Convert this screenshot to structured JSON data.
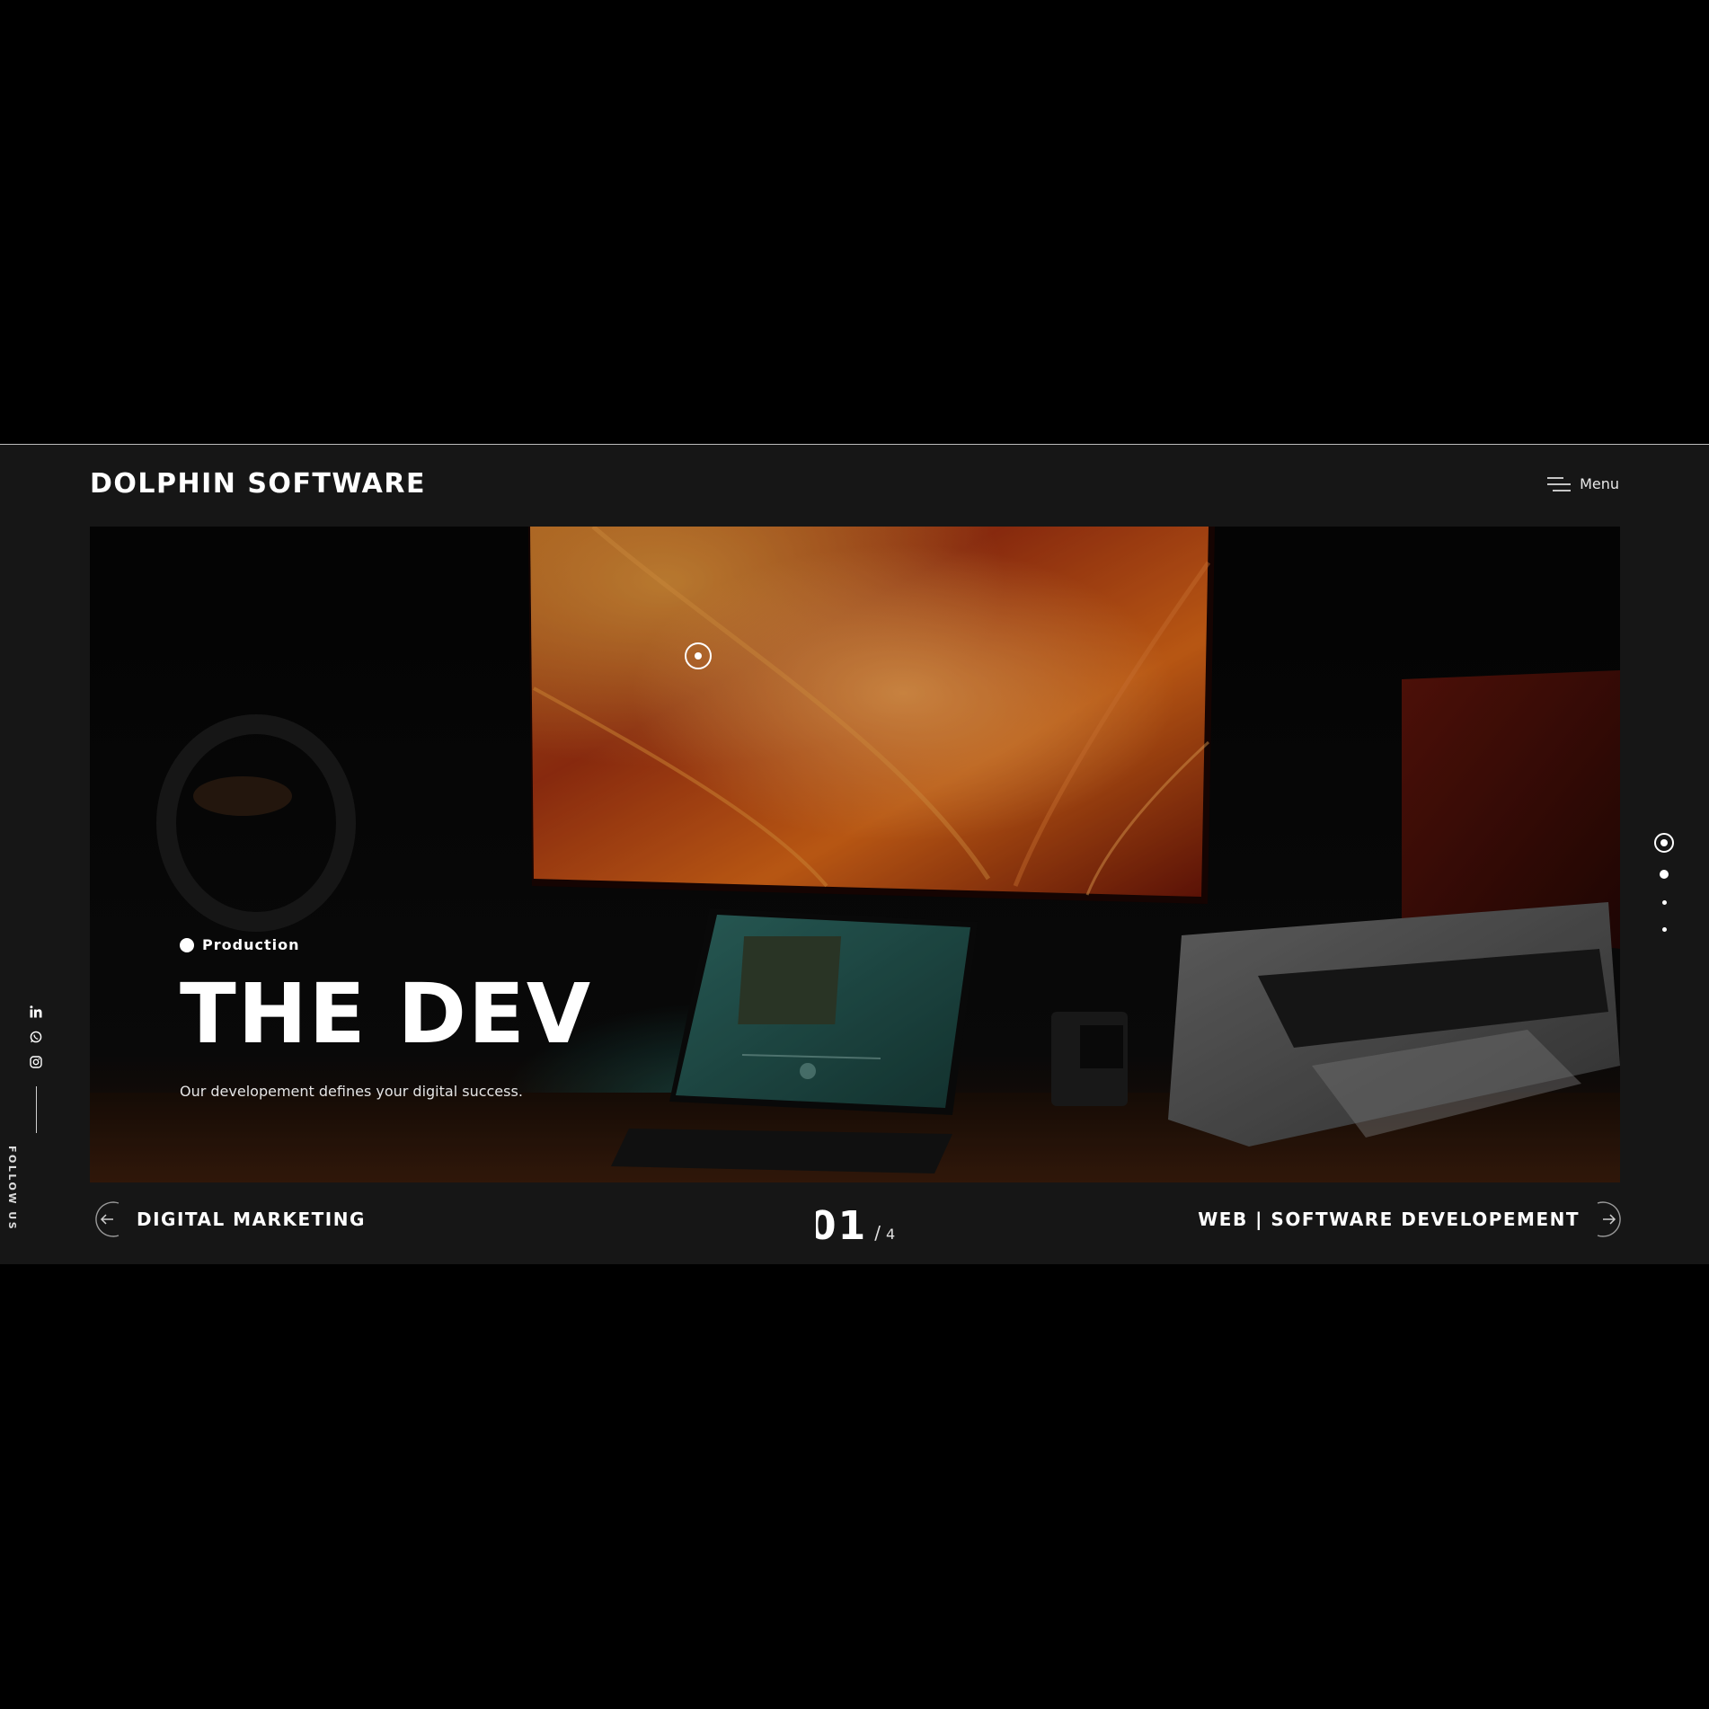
{
  "brand": {
    "name": "DOLPHIN SOFTWARE"
  },
  "menu": {
    "label": "Menu",
    "icon": "menu-lines-icon"
  },
  "hero": {
    "eyebrow": "Production",
    "title": "THE DEV",
    "subtitle": "Our developement defines your digital success.",
    "accent_colors": [
      "#ff6a1a",
      "#b83b10",
      "#1c4f49"
    ]
  },
  "social": {
    "icons": [
      "linkedin-icon",
      "whatsapp-icon",
      "instagram-icon"
    ],
    "label": "FOLLOW US"
  },
  "slides": {
    "current": "01",
    "separator": "/",
    "total": "4",
    "count": 4,
    "active_index": 0
  },
  "navigation": {
    "prev_label": "DIGITAL MARKETING",
    "next_label": "WEB | SOFTWARE DEVELOPEMENT"
  },
  "colors": {
    "page_background": "#000000",
    "site_background": "#161616",
    "text": "#ffffff"
  }
}
